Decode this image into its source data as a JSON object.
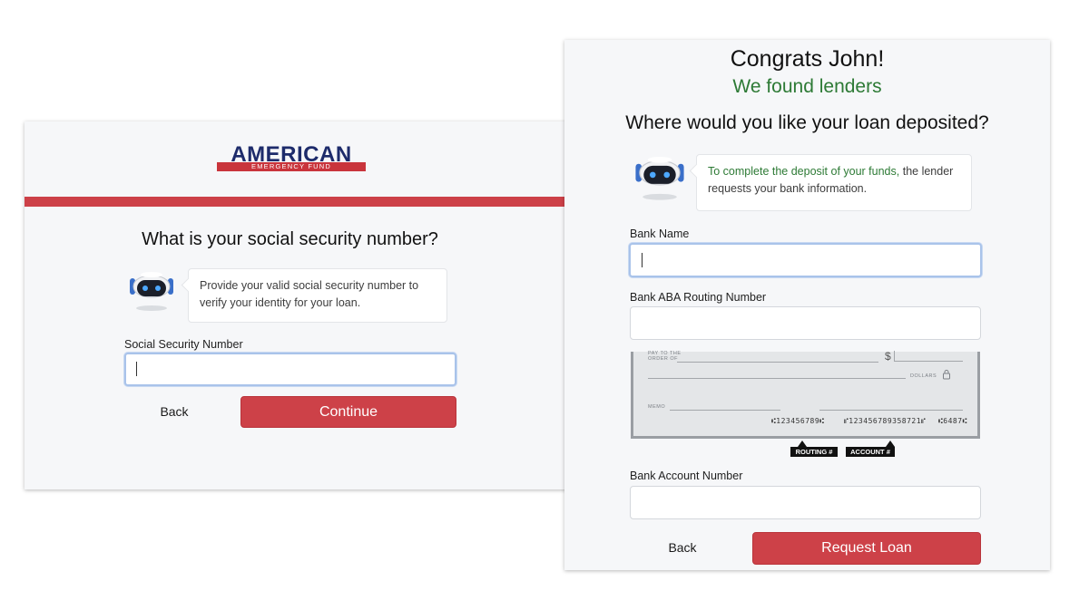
{
  "left": {
    "logo": {
      "main": "AMERICAN",
      "sub": "EMERGENCY FUND"
    },
    "progress": {
      "percent": 95
    },
    "title": "What is your social security number?",
    "bubble": "Provide your valid social security number to verify your identity for your loan.",
    "ssn_label": "Social Security Number",
    "ssn_value": "",
    "back_label": "Back",
    "continue_label": "Continue"
  },
  "right": {
    "congrats": "Congrats John!",
    "found": "We found lenders",
    "question": "Where would you like your loan deposited?",
    "bubble_green": "To complete the deposit of your funds,",
    "bubble_rest": " the lender requests your bank information.",
    "bank_name_label": "Bank Name",
    "bank_name_value": "",
    "routing_label": "Bank ABA Routing Number",
    "routing_value": "",
    "check": {
      "pay_to": "PAY TO THE",
      "order_of": "ORDER OF",
      "dollar_sign": "$",
      "dollars": "DOLLARS",
      "memo": "MEMO",
      "micr_routing": "⑆123456789⑆",
      "micr_account": "⑈123456789358721⑈",
      "micr_check": "⑆6487⑆",
      "routing_tag": "ROUTING #",
      "account_tag": "ACCOUNT #"
    },
    "account_label": "Bank Account Number",
    "account_value": "",
    "back_label": "Back",
    "request_label": "Request Loan"
  },
  "colors": {
    "brand_red": "#cd4148",
    "brand_navy": "#1d2b6b",
    "success_green": "#2d7a35",
    "focus_blue": "#a9c3ea"
  },
  "icons": {
    "assistant": "robot-assistant-icon",
    "lock": "lock-icon"
  }
}
